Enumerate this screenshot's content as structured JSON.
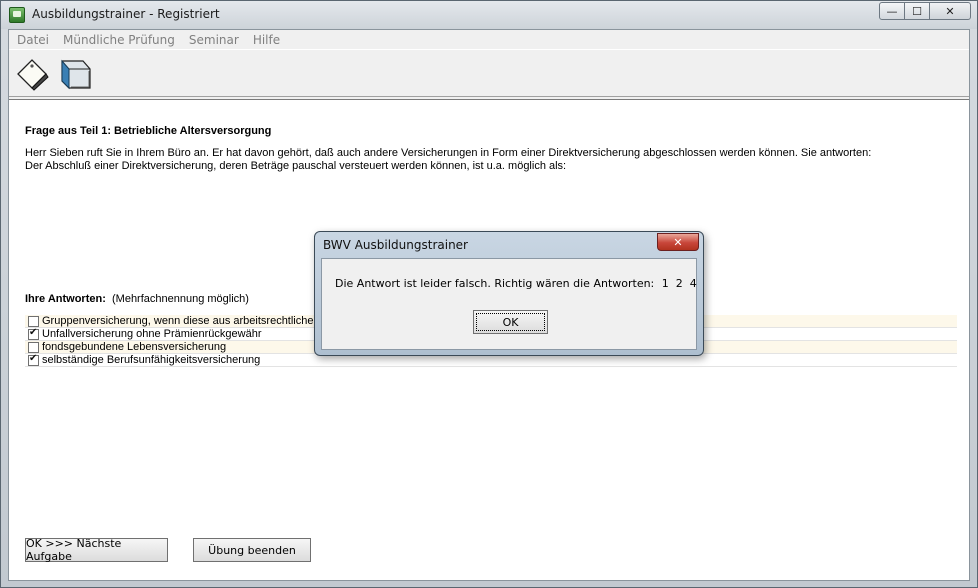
{
  "window": {
    "title": "Ausbildungstrainer - Registriert",
    "controls": {
      "minimize": "—",
      "maximize": "☐",
      "close": "✕"
    }
  },
  "menu": {
    "items": [
      "Datei",
      "Mündliche Prüfung",
      "Seminar",
      "Hilfe"
    ]
  },
  "toolbar": {
    "icons": [
      "label-tag-icon",
      "book-icon"
    ]
  },
  "question": {
    "title": "Frage aus Teil 1: Betriebliche Altersversorgung",
    "line1": "Herr Sieben ruft Sie in Ihrem Büro an. Er hat davon gehört, daß auch andere Versicherungen in Form einer Direktversicherung abgeschlossen werden können. Sie antworten:",
    "line2": "Der Abschluß einer Direktversicherung, deren Beträge pauschal versteuert werden können, ist u.a. möglich als:"
  },
  "answers": {
    "heading": "Ihre Antworten:",
    "hint": "(Mehrfachnennung möglich)",
    "items": [
      {
        "label": "Gruppenversicherung, wenn diese aus arbeitsrechtlichem G",
        "checked": false
      },
      {
        "label": "Unfallversicherung ohne Prämienrückgewähr",
        "checked": true
      },
      {
        "label": "fondsgebundene Lebensversicherung",
        "checked": false
      },
      {
        "label": "selbständige Berufsunfähigkeitsversicherung",
        "checked": true
      }
    ]
  },
  "buttons": {
    "next": "OK >>> Nächste Aufgabe",
    "end": "Übung beenden"
  },
  "dialog": {
    "title": "BWV Ausbildungstrainer",
    "close": "✕",
    "message": "Die Antwort ist leider falsch. Richtig wären die Antworten:",
    "correct": "1  2  4",
    "ok": "OK"
  }
}
